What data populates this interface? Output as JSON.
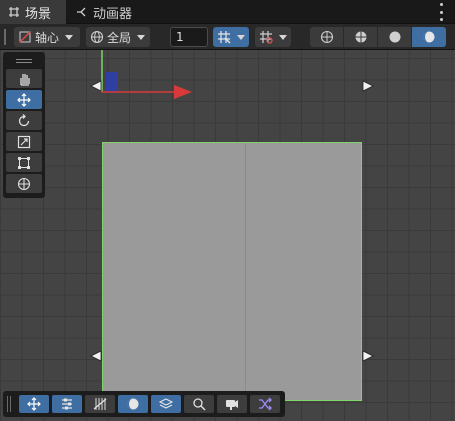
{
  "tabs": [
    {
      "label": "场景",
      "icon": "grid-icon",
      "active": true
    },
    {
      "label": "动画器",
      "icon": "animator-icon",
      "active": false
    }
  ],
  "toolbar": {
    "pivot_label": "轴心",
    "space_label": "全局",
    "grid_value": "1",
    "accent": "#3f6ea3"
  },
  "tool_palette": [
    "hand-tool",
    "move-tool",
    "rotate-tool",
    "scale-tool",
    "rect-tool",
    "transform-tool"
  ],
  "bottom_bar": [
    "move",
    "settings",
    "grid",
    "shading",
    "layers",
    "search",
    "camera",
    "shuffle"
  ]
}
